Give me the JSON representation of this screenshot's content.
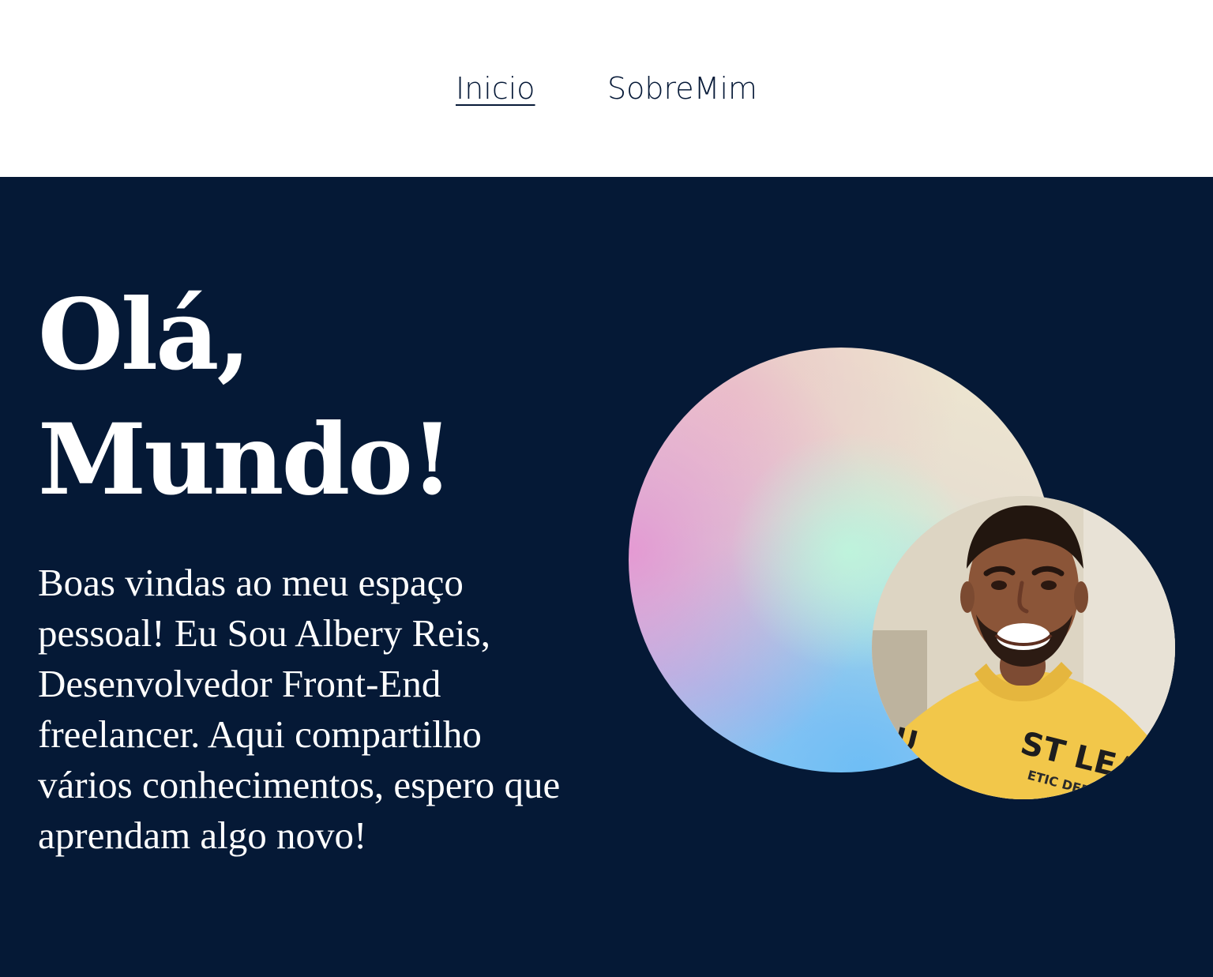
{
  "nav": {
    "items": [
      {
        "label": "Inicio",
        "active": true
      },
      {
        "label": "SobreMim",
        "active": false
      }
    ]
  },
  "hero": {
    "title_line1": "Olá,",
    "title_line2": "Mundo!",
    "intro": "Boas vindas ao meu espaço pessoal! Eu Sou Albery Reis, Desenvolvedor Front-End freelancer. Aqui compartilho vários conhecimentos, espero que aprendam algo novo!"
  },
  "colors": {
    "background_dark": "#051936",
    "nav_background": "#ffffff",
    "nav_text": "#071a38",
    "hero_text": "#ffffff"
  },
  "images": {
    "decorative": "gradient-circle",
    "profile": "profile-photo"
  }
}
